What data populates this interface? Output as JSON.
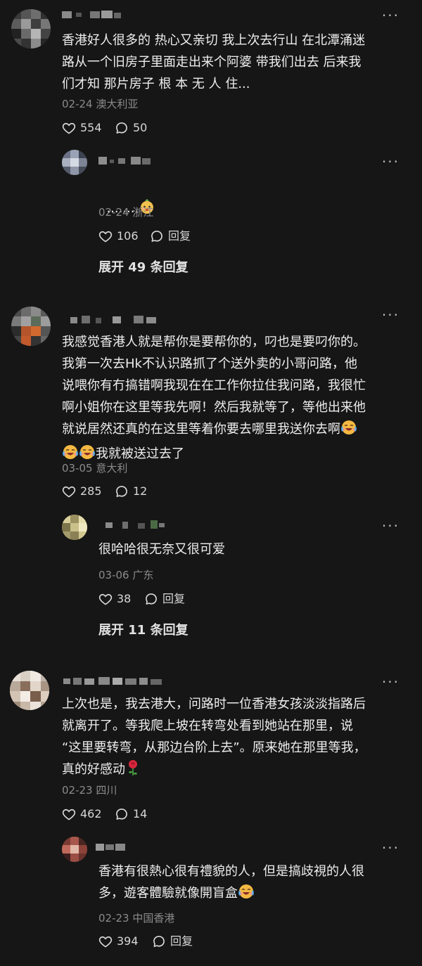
{
  "comments": [
    {
      "content": "香港好人很多的 热心又亲切 我上次去行山 在北潭涌迷\n路从一个旧房子里面走出来个阿婆 带我们出去 后来我\n们才知 那片房子 根 本 无 人 住...",
      "date": "02-24",
      "location": "澳大利亚",
      "likes": "554",
      "replies": "50",
      "reply": {
        "content": "........",
        "emoji_icon": "cute-face-sticker-icon",
        "date": "02-24",
        "location": "浙江",
        "likes": "106",
        "reply_label": "回复"
      },
      "expand_label": "展开 49 条回复"
    },
    {
      "content": "我感觉香港人就是帮你是要帮你的，叼也是要叼你的。\n我第一次去Hk不认识路抓了个送外卖的小哥问路，他\n说喂你有冇搞错啊我现在在工作你拉住我问路，我很忙\n啊小姐你在这里等我先啊！然后我就等了，等他出来他\n就说居然还真的在这里等着你要去哪里我送你去啊",
      "content_tail": "我就被送过去了",
      "emoji_icon": "crying-laughing-face-icon",
      "date": "03-05",
      "location": "意大利",
      "likes": "285",
      "replies": "12",
      "reply": {
        "content": "很哈哈很无奈又很可爱",
        "date": "03-06",
        "location": "广东",
        "likes": "38",
        "reply_label": "回复"
      },
      "expand_label": "展开 11 条回复"
    },
    {
      "content": "上次也是，我去港大，问路时一位香港女孩淡淡指路后\n就离开了。等我爬上坡在转弯处看到她站在那里，说\n“这里要转弯，从那边台阶上去”。原来她在那里等我，\n真的好感动",
      "emoji_icon": "rose-icon",
      "date": "02-23",
      "location": "四川",
      "likes": "462",
      "replies": "14",
      "reply": {
        "content": "香港有很熱心很有禮貌的人，但是搞歧視的人很\n多，遊客體驗就像開盲盒",
        "emoji_icon": "crying-laughing-face-icon",
        "date": "02-23",
        "location": "中国香港",
        "likes": "394",
        "reply_label": "回复"
      }
    }
  ],
  "more_icon_label": "···",
  "colors": {
    "background": "#161616",
    "text": "#eeeeee",
    "meta": "#8b8b8b"
  }
}
